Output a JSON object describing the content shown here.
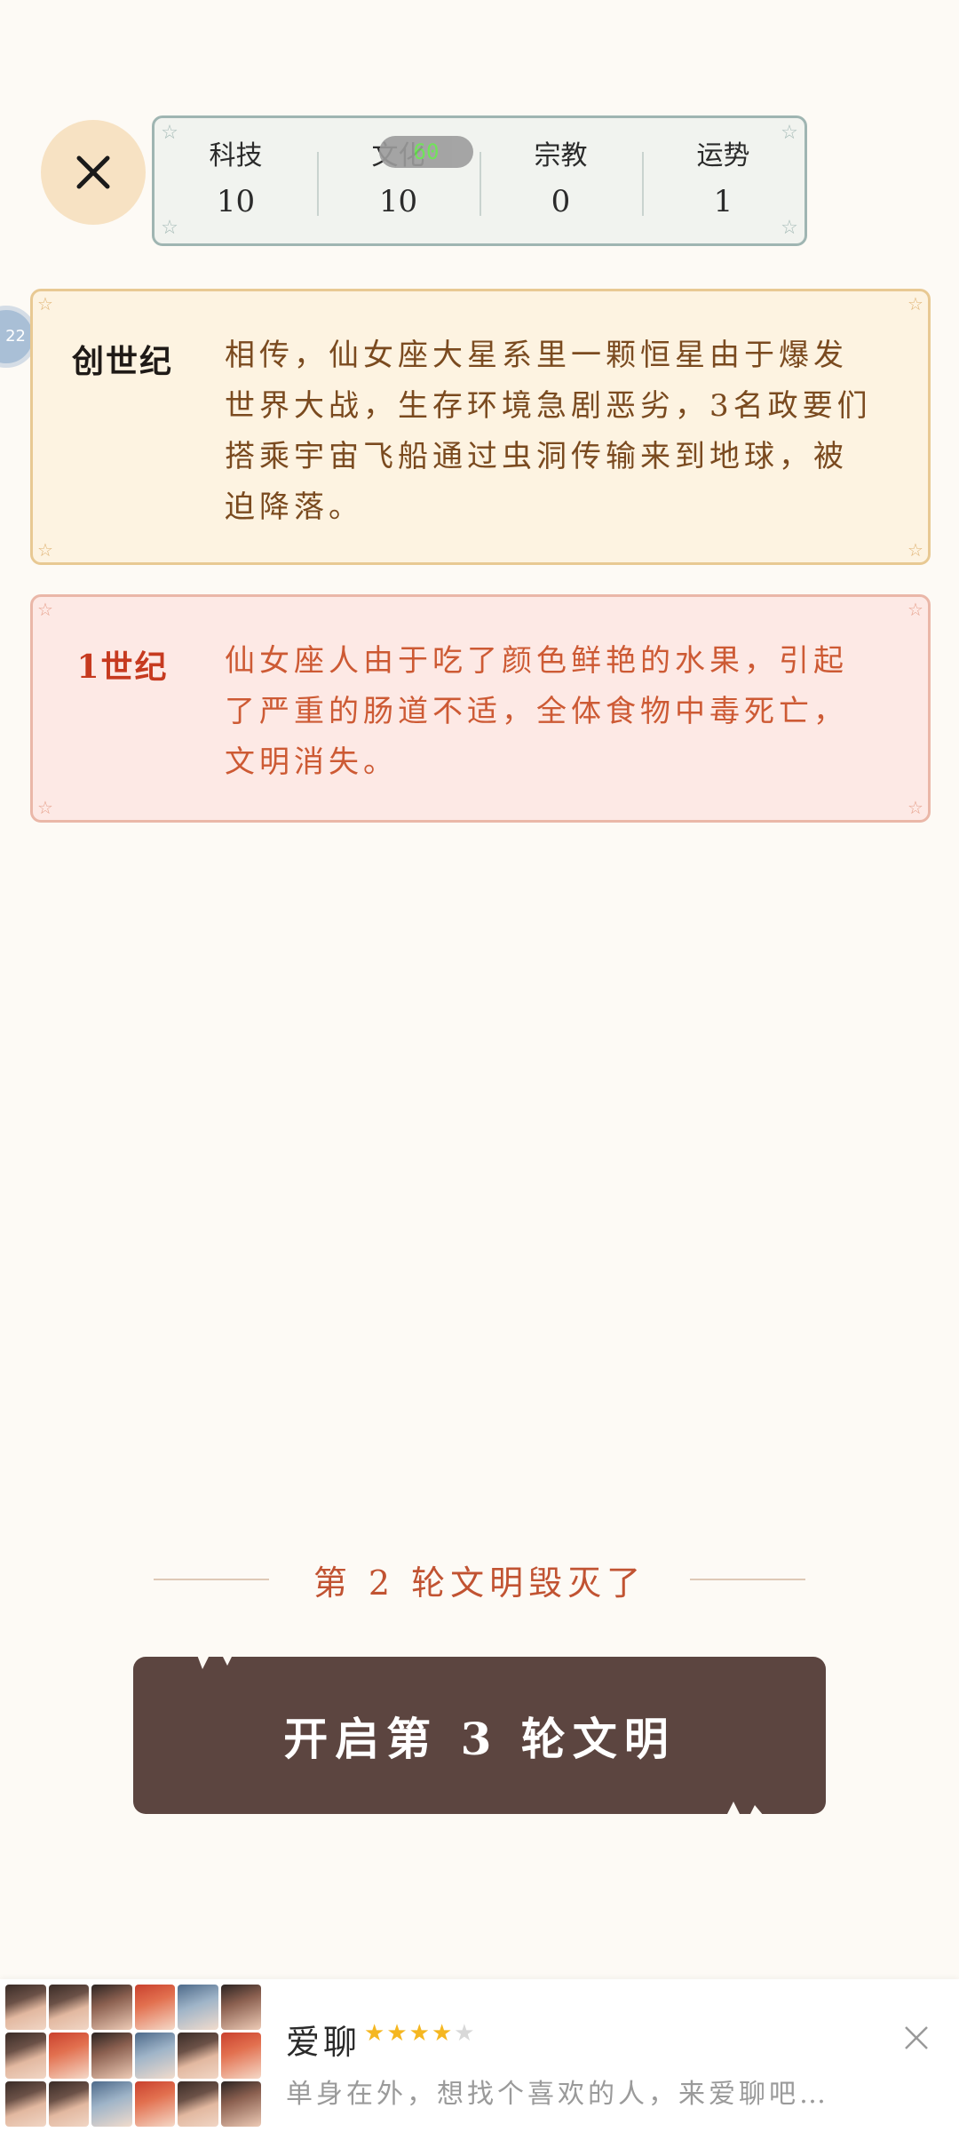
{
  "close_button": {
    "icon": "close-icon"
  },
  "stats": [
    {
      "label": "科技",
      "value": "10"
    },
    {
      "label": "文化",
      "value": "10"
    },
    {
      "label": "宗教",
      "value": "0"
    },
    {
      "label": "运势",
      "value": "1"
    }
  ],
  "fps_badge": "60",
  "side_bubble": "22",
  "events": [
    {
      "title": "创世纪",
      "text": "相传，仙女座大星系里一颗恒星由于爆发世界大战，生存环境急剧恶劣，3名政要们搭乘宇宙飞船通过虫洞传输来到地球，被迫降落。"
    },
    {
      "title": "1世纪",
      "text": "仙女座人由于吃了颜色鲜艳的水果，引起了严重的肠道不适，全体食物中毒死亡，文明消失。"
    }
  ],
  "destroyed_text": "第 2 轮文明毁灭了",
  "start_button": "开启第 3 轮文明",
  "ad": {
    "title": "爱聊",
    "rating": 4,
    "rating_max": 5,
    "description": "单身在外，想找个喜欢的人，来爱聊吧…"
  },
  "colors": {
    "background": "#fdfaf5",
    "button": "#5c4540",
    "genesis_card": "#fdf3e1",
    "century_card": "#fde9e5",
    "destroyed_text": "#c15332"
  }
}
